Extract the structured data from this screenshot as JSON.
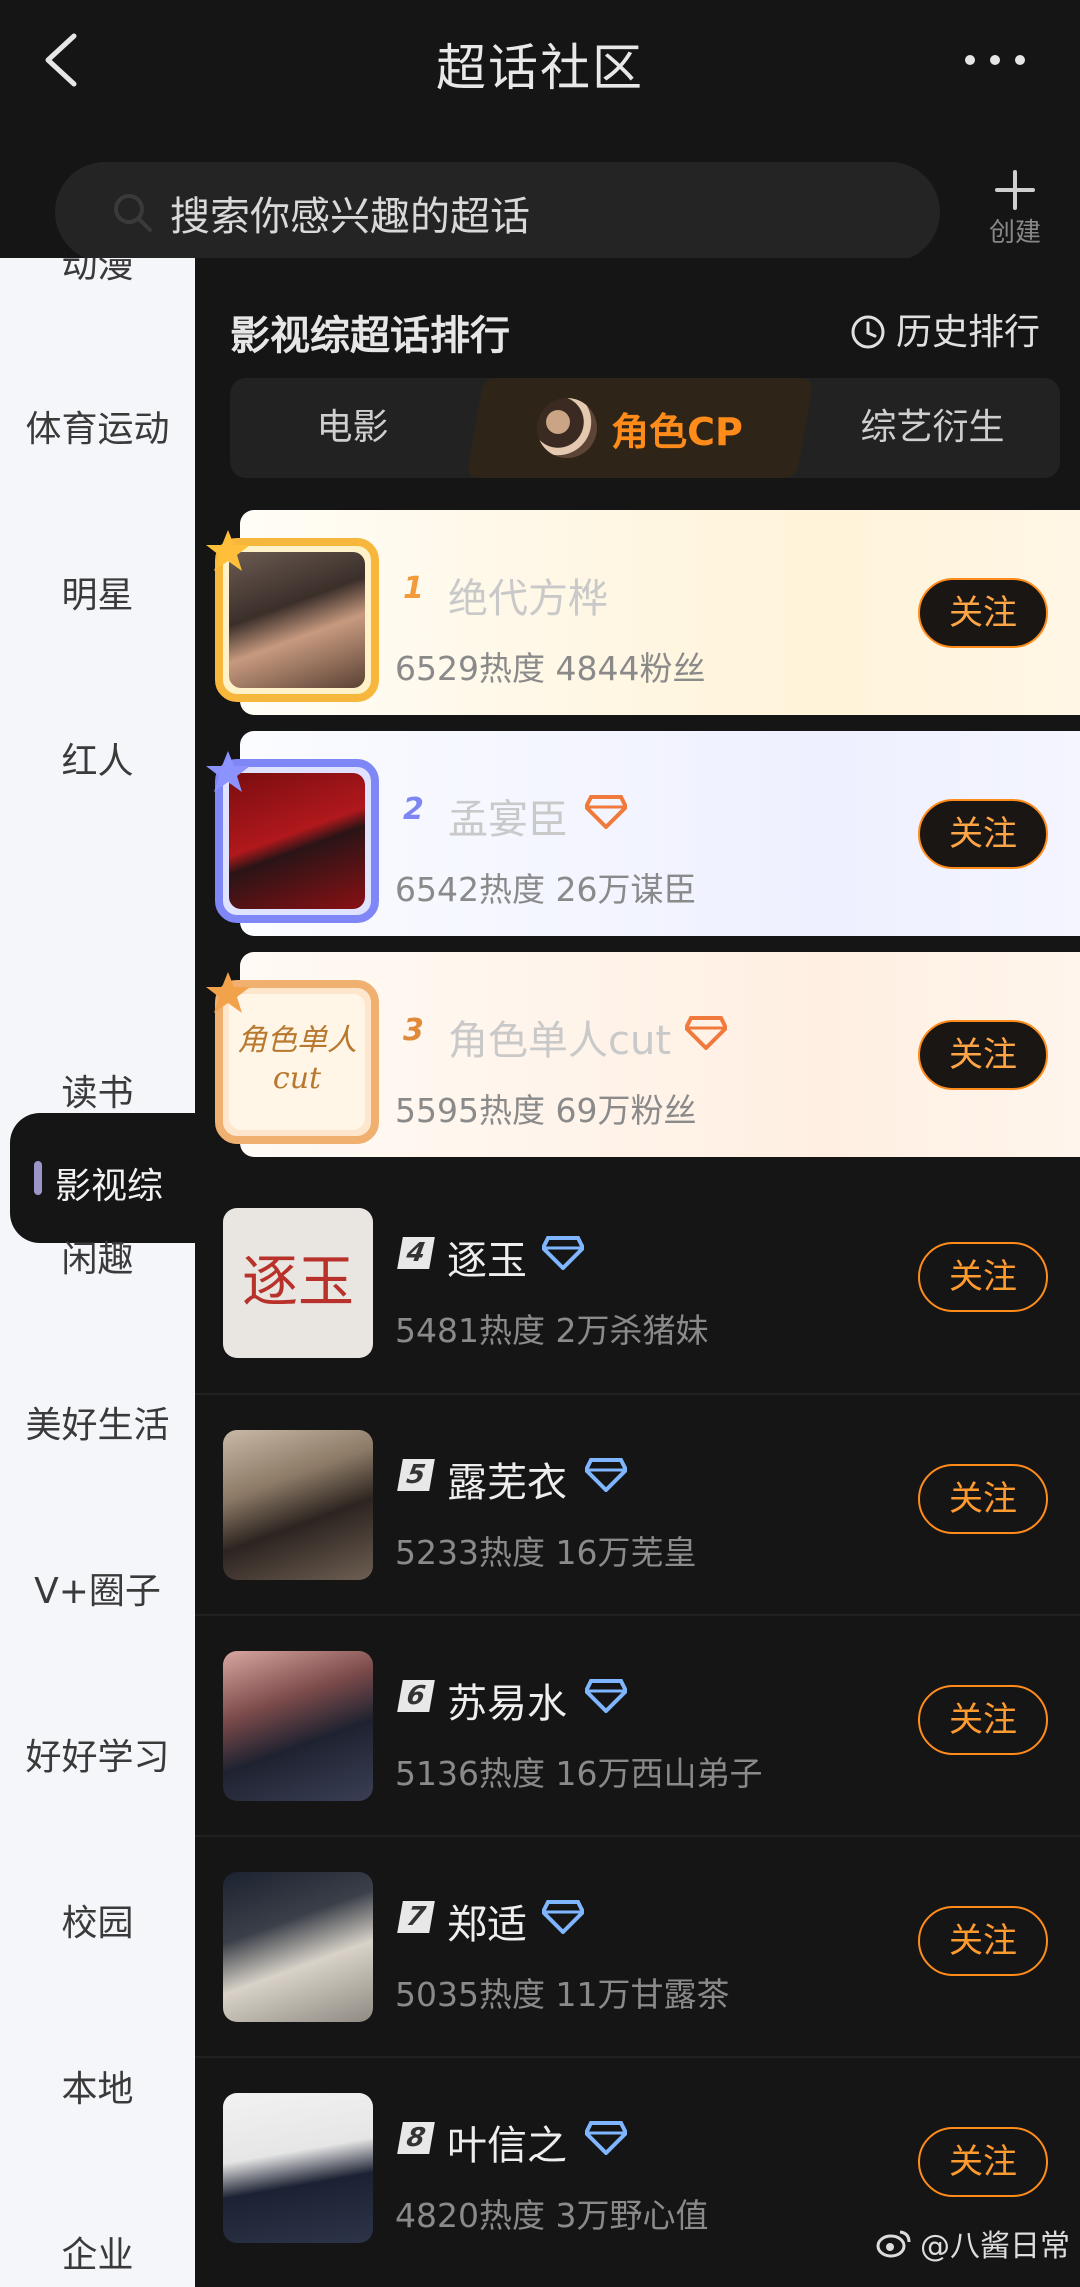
{
  "header": {
    "title": "超话社区"
  },
  "search": {
    "placeholder": "搜索你感兴趣的超话",
    "create_label": "创建"
  },
  "sidebar": {
    "items": [
      "动漫",
      "体育运动",
      "明星",
      "红人",
      "影视综",
      "读书",
      "闲趣",
      "美好生活",
      "V+圈子",
      "好好学习",
      "校园",
      "本地",
      "企业"
    ],
    "active": "影视综"
  },
  "section": {
    "title": "影视综超话排行",
    "history_label": "历史排行"
  },
  "tabs": [
    {
      "label": "电影",
      "active": false
    },
    {
      "label": "角色CP",
      "active": true
    },
    {
      "label": "综艺衍生",
      "active": false
    }
  ],
  "follow_label": "关注",
  "rankings": [
    {
      "rank": "1",
      "name": "绝代方桦",
      "stats": "6529热度 4844粉丝"
    },
    {
      "rank": "2",
      "name": "孟宴臣",
      "stats": "6542热度 26万谋臣"
    },
    {
      "rank": "3",
      "name": "角色单人cut",
      "stats": "5595热度 69万粉丝",
      "thumb_text": "角色单人cut"
    },
    {
      "rank": "4",
      "name": "逐玉",
      "stats": "5481热度 2万杀猪妹",
      "thumb_text": "逐玉"
    },
    {
      "rank": "5",
      "name": "露芜衣",
      "stats": "5233热度 16万芜皇"
    },
    {
      "rank": "6",
      "name": "苏易水",
      "stats": "5136热度 16万西山弟子"
    },
    {
      "rank": "7",
      "name": "郑适",
      "stats": "5035热度 11万甘露茶"
    },
    {
      "rank": "8",
      "name": "叶信之",
      "stats": "4820热度 3万野心值"
    }
  ],
  "watermark": "@八酱日常",
  "colors": {
    "accent": "#ff8c1a",
    "background": "#151515",
    "sidebar_bg": "#f5f6fa"
  }
}
